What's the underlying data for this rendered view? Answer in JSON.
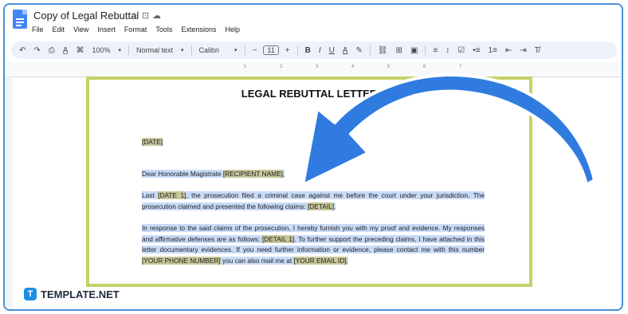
{
  "app": {
    "doc_title": "Copy of Legal Rebuttal",
    "title_icons": [
      "☆",
      "⊡",
      "☁"
    ]
  },
  "menu": [
    "File",
    "Edit",
    "View",
    "Insert",
    "Format",
    "Tools",
    "Extensions",
    "Help"
  ],
  "toolbar": {
    "undo": "↶",
    "redo": "↷",
    "print": "⎙",
    "spell": "A̲",
    "paint": "⌘",
    "zoom": "100%",
    "style": "Normal text",
    "font": "Calibri",
    "minus": "−",
    "size": "11",
    "plus": "+",
    "bold": "B",
    "italic": "I",
    "underline": "U",
    "textcolor": "A",
    "highlight": "✎",
    "link": "⛓",
    "comment": "⊞",
    "image": "▣",
    "align": "≡",
    "linespacing": "↕",
    "checklist": "☑",
    "bullets": "•≡",
    "numbers": "1≡",
    "outdent": "⇤",
    "indent": "⇥",
    "clear": "T̸"
  },
  "ruler": [
    "1",
    "2",
    "3",
    "4",
    "5",
    "6",
    "7"
  ],
  "letter": {
    "title": "LEGAL REBUTTAL LETTER",
    "date": "[DATE]",
    "salutation_pre": "Dear Honorable Magistrate ",
    "salutation_ph": "[RECIPIENT NAME]",
    "salutation_post": ",",
    "p1_a": "Last ",
    "p1_ph1": "[DATE 1]",
    "p1_b": ", the prosecution filed a criminal case against me before the court under your jurisdiction. The prosecution claimed and presented the following claims: ",
    "p1_ph2": "[DETAIL]",
    "p1_c": ".",
    "p2_a": "In response to the said claims of the prosecution, I hereby furnish you with my proof and evidence. My responses and affirmative defenses are as follows: ",
    "p2_ph1": "[DETAIL 1]",
    "p2_b": ". To further support the preceding claims, I have attached in this letter documentary evidences. If you need further information or evidence, please contact me with this number ",
    "p2_ph2": "[YOUR PHONE NUMBER]",
    "p2_c": " you can also mail me at ",
    "p2_ph3": "[YOUR EMAIL ID]",
    "p2_d": "."
  },
  "brand": {
    "icon": "T",
    "text": "TEMPLATE.NET"
  },
  "colors": {
    "accent": "#4a90d9",
    "page_border": "#c5d166",
    "arrow": "#2f7be0",
    "selection": "#c9dbf7",
    "placeholder": "#c7c79a"
  }
}
